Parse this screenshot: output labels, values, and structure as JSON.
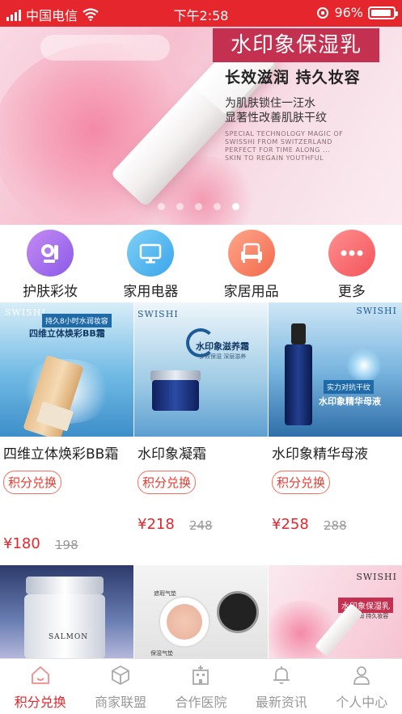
{
  "status_bar": {
    "carrier": "中国电信",
    "time": "下午2:58",
    "battery": "96%",
    "battery_level": 0.96
  },
  "banner": {
    "search_placeholder": "",
    "title": "水印象保湿乳",
    "subtitle": "长效滋润  持久妆容",
    "desc_line1": "为肌肤锁住一汪水",
    "desc_line2": "显著性改善肌肤干纹",
    "english_text": "SPECIAL TECHNOLOGY MAGIC OF SWISSHI FROM SWITZERLAND PERFECT FOR TIME ALONG ... SKIN TO REGAIN YOUTHFUL",
    "slide_count": 5,
    "active_slide": 4
  },
  "categories": [
    {
      "label": "护肤彩妆",
      "icon": "cosmetics-icon",
      "color": "#9b68ee"
    },
    {
      "label": "家用电器",
      "icon": "monitor-icon",
      "color": "#4bafee"
    },
    {
      "label": "家居用品",
      "icon": "sofa-icon",
      "color": "#f47a5c"
    },
    {
      "label": "更多",
      "icon": "more-dots-icon",
      "color": "#f2616a"
    }
  ],
  "products": [
    {
      "name": "四维立体焕彩BB霜",
      "badge": "积分兑换",
      "price": "¥180",
      "original_price": "198",
      "ad": {
        "tag": "持久8小时水润妆容",
        "headline": "四维立体焕彩BB霜",
        "brand": "SWISHI"
      }
    },
    {
      "name": "水印象凝霜",
      "badge": "积分兑换",
      "price": "¥218",
      "original_price": "248",
      "ad": {
        "headline": "水印象滋养霜",
        "tagline": "多效保湿 深层滋养",
        "brand": "SWISHI"
      }
    },
    {
      "name": "水印象精华母液",
      "badge": "积分兑换",
      "price": "¥258",
      "original_price": "288",
      "ad": {
        "tag": "实力对抗干纹",
        "headline": "水印象精华母液",
        "brand": "SWISHI"
      }
    },
    {
      "name": "",
      "ad": {
        "brand": "SALMON"
      }
    },
    {
      "name": "",
      "ad": {
        "label_top": "遮瑕气垫",
        "label_bottom": "保湿气垫"
      }
    },
    {
      "name": "",
      "ad": {
        "headline": "水印象保湿乳",
        "tagline": "长效滋润 持久妆容",
        "brand": "SWISHI"
      }
    }
  ],
  "bottom_nav": [
    {
      "label": "积分兑换",
      "icon": "home-icon",
      "active": true
    },
    {
      "label": "商家联盟",
      "icon": "cube-icon",
      "active": false
    },
    {
      "label": "合作医院",
      "icon": "hospital-icon",
      "active": false
    },
    {
      "label": "最新资讯",
      "icon": "bell-icon",
      "active": false
    },
    {
      "label": "个人中心",
      "icon": "person-icon",
      "active": false
    }
  ],
  "colors": {
    "accent": "#e5262c",
    "nav_inactive": "#999999"
  }
}
